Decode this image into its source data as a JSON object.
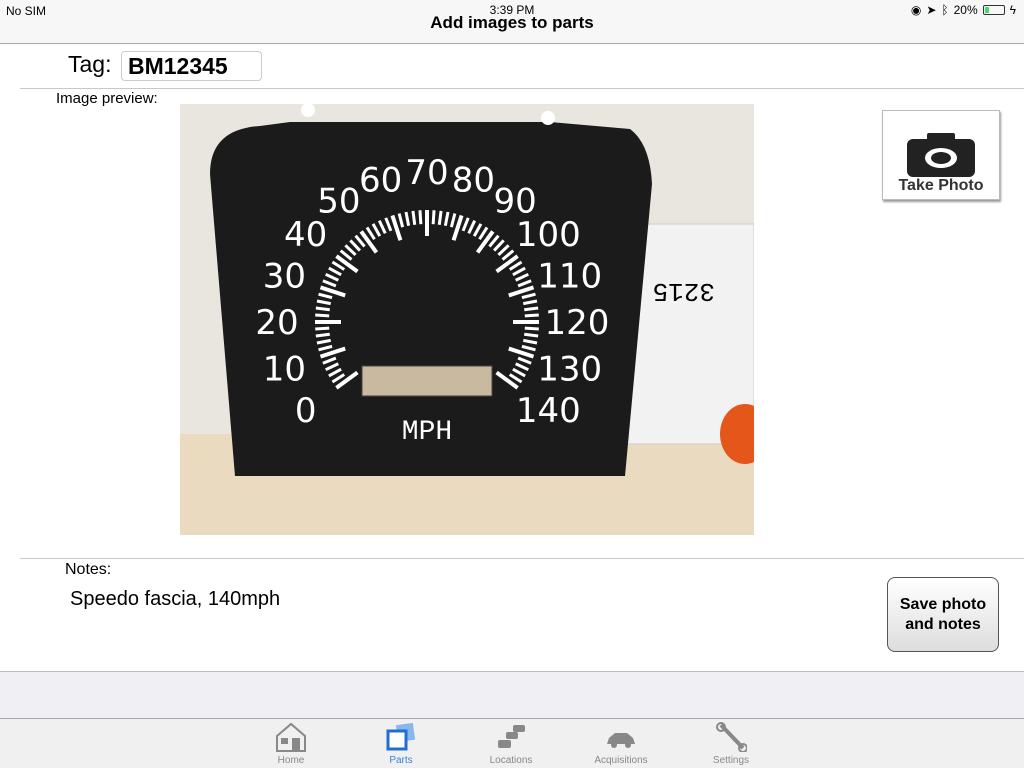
{
  "status_bar": {
    "carrier": "No SIM",
    "time": "3:39 PM",
    "battery": "20%",
    "battery_level": 0.2
  },
  "nav": {
    "title": "Add images to parts"
  },
  "form": {
    "tag_label": "Tag:",
    "tag_value": "BM12345",
    "preview_label": "Image preview:",
    "take_photo_label": "Take Photo",
    "notes_label": "Notes:",
    "notes_value": "Speedo fascia, 140mph",
    "save_label": "Save photo and notes"
  },
  "photo": {
    "dial_numbers": [
      "0",
      "10",
      "20",
      "30",
      "40",
      "50",
      "60",
      "70",
      "80",
      "90",
      "100",
      "110",
      "120",
      "130",
      "140"
    ],
    "unit": "MPH",
    "box_text": "3215"
  },
  "tabs": [
    {
      "label": "Home",
      "icon": "house-icon",
      "active": false
    },
    {
      "label": "Parts",
      "icon": "photos-icon",
      "active": true
    },
    {
      "label": "Locations",
      "icon": "cars-stack-icon",
      "active": false
    },
    {
      "label": "Acquisitions",
      "icon": "car-icon",
      "active": false
    },
    {
      "label": "Settings",
      "icon": "wrench-icon",
      "active": false
    }
  ],
  "colors": {
    "accent": "#3b82d6",
    "bar": "#f7f7f7"
  }
}
